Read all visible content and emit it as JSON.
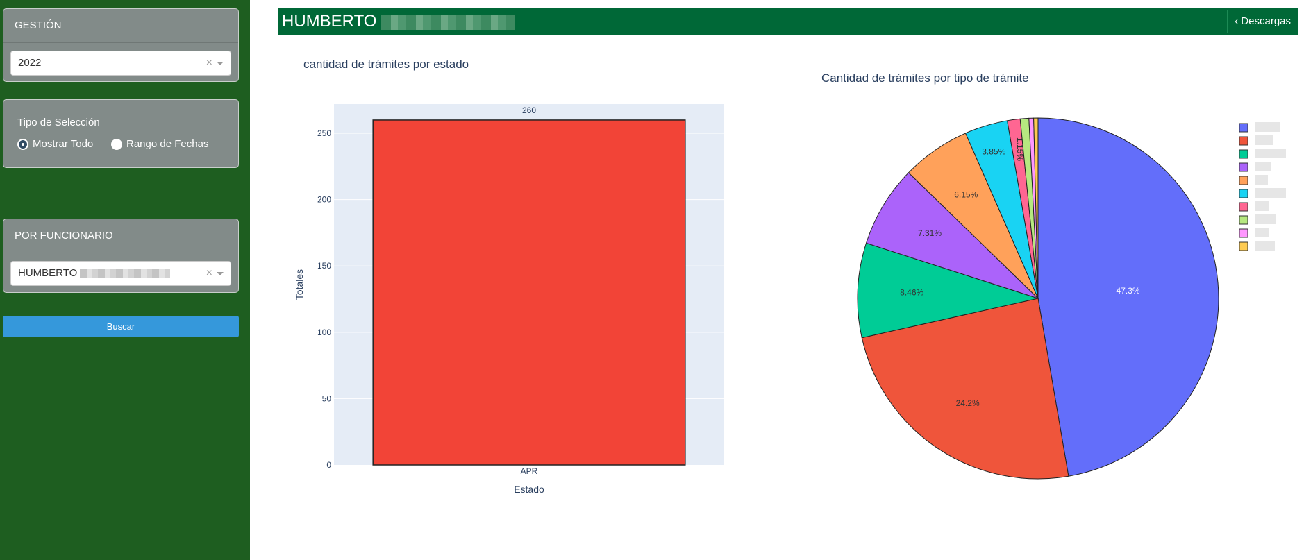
{
  "sidebar": {
    "gestion": {
      "header": "GESTIÓN",
      "value": "2022",
      "clear": "×"
    },
    "tipo": {
      "title": "Tipo de Selección",
      "options": [
        "Mostrar Todo",
        "Rango de Fechas"
      ],
      "selected": "Mostrar Todo"
    },
    "funcionario": {
      "header": "POR FUNCIONARIO",
      "value": "HUMBERTO",
      "clear": "×"
    },
    "buscar": "Buscar"
  },
  "topbar": {
    "title": "HUMBERTO",
    "download": "‹ Descargas"
  },
  "colors": {
    "sidebar": "#1e5e20",
    "topbar": "#006837",
    "button": "#3598db",
    "bar": "#f24437"
  },
  "chart_data": [
    {
      "type": "bar",
      "title": "cantidad de trámites por estado",
      "categories": [
        "APR"
      ],
      "values": [
        260
      ],
      "data_labels": [
        "260"
      ],
      "xlabel": "Estado",
      "ylabel": "Totales",
      "ylim": [
        0,
        272
      ],
      "yticks": [
        0,
        50,
        100,
        150,
        200,
        250
      ],
      "grid": true
    },
    {
      "type": "pie",
      "title": "Cantidad de trámites por tipo de trámite",
      "values": [
        47.3,
        24.2,
        8.46,
        7.31,
        6.15,
        3.85,
        1.15,
        0.77,
        0.42,
        0.39
      ],
      "labels": [
        "47.3%",
        "24.2%",
        "8.46%",
        "7.31%",
        "6.15%",
        "3.85%",
        "1.15%",
        "",
        "",
        ""
      ],
      "colors": [
        "#636efa",
        "#ef553b",
        "#00cc96",
        "#ab63fa",
        "#ffa15a",
        "#19d3f3",
        "#ff6692",
        "#b6e880",
        "#ff97ff",
        "#fecb52"
      ],
      "legend": "top-right"
    }
  ]
}
